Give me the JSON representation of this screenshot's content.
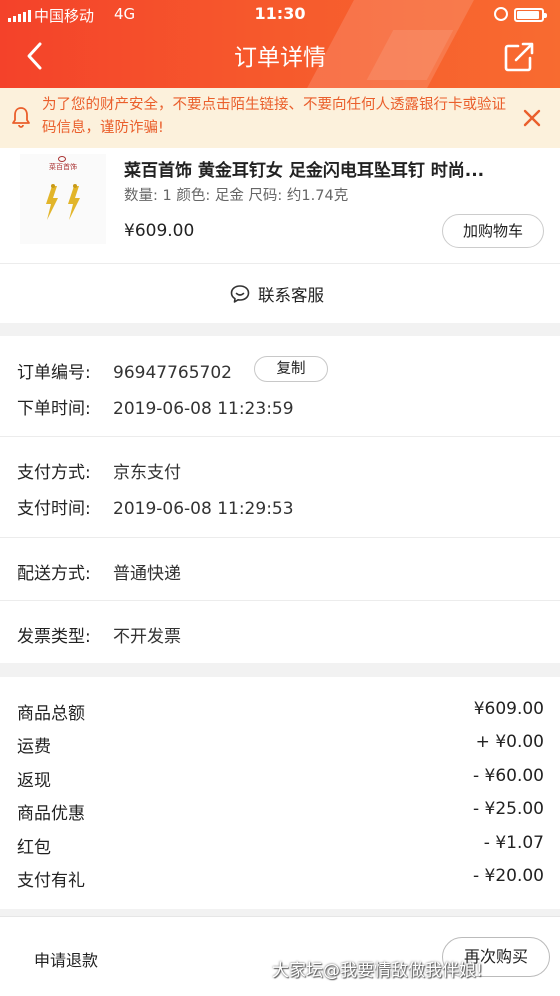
{
  "status": {
    "carrier": "中国移动",
    "network": "4G",
    "time": "11:30"
  },
  "nav": {
    "title": "订单详情",
    "back_icon": "chevron-left-icon",
    "share_icon": "share-icon"
  },
  "notice": {
    "text": "为了您的财产安全，不要点击陌生链接、不要向任何人透露银行卡或验证码信息，谨防诈骗!",
    "color": "#ea5f2c",
    "background": "#fcf1dc"
  },
  "product": {
    "brand_logo_text": "菜百首饰",
    "title": "菜百首饰 黄金耳钉女 足金闪电耳坠耳钉 时尚...",
    "spec": "数量: 1 颜色: 足金 尺码: 约1.74克",
    "price": "¥609.00",
    "cart_button": "加购物车"
  },
  "service": {
    "label": "联系客服"
  },
  "order": {
    "number_label": "订单编号:",
    "number": "96947765702",
    "copy_button": "复制",
    "created_label": "下单时间:",
    "created": "2019-06-08 11:23:59",
    "pay_method_label": "支付方式:",
    "pay_method": "京东支付",
    "pay_time_label": "支付时间:",
    "pay_time": "2019-06-08 11:29:53",
    "delivery_label": "配送方式:",
    "delivery": "普通快递",
    "invoice_label": "发票类型:",
    "invoice": "不开发票"
  },
  "amounts": [
    {
      "label": "商品总额",
      "value": "¥609.00"
    },
    {
      "label": "运费",
      "value": "+ ¥0.00"
    },
    {
      "label": "返现",
      "value": "- ¥60.00"
    },
    {
      "label": "商品优惠",
      "value": "- ¥25.00"
    },
    {
      "label": "红包",
      "value": "- ¥1.07"
    },
    {
      "label": "支付有礼",
      "value": "- ¥20.00"
    }
  ],
  "bottom": {
    "refund": "申请退款",
    "rebuy": "再次购买"
  },
  "watermark": "大家坛@我要情敌做我伴娘!",
  "colors": {
    "header_start": "#f4422a",
    "header_end": "#f86b30"
  }
}
